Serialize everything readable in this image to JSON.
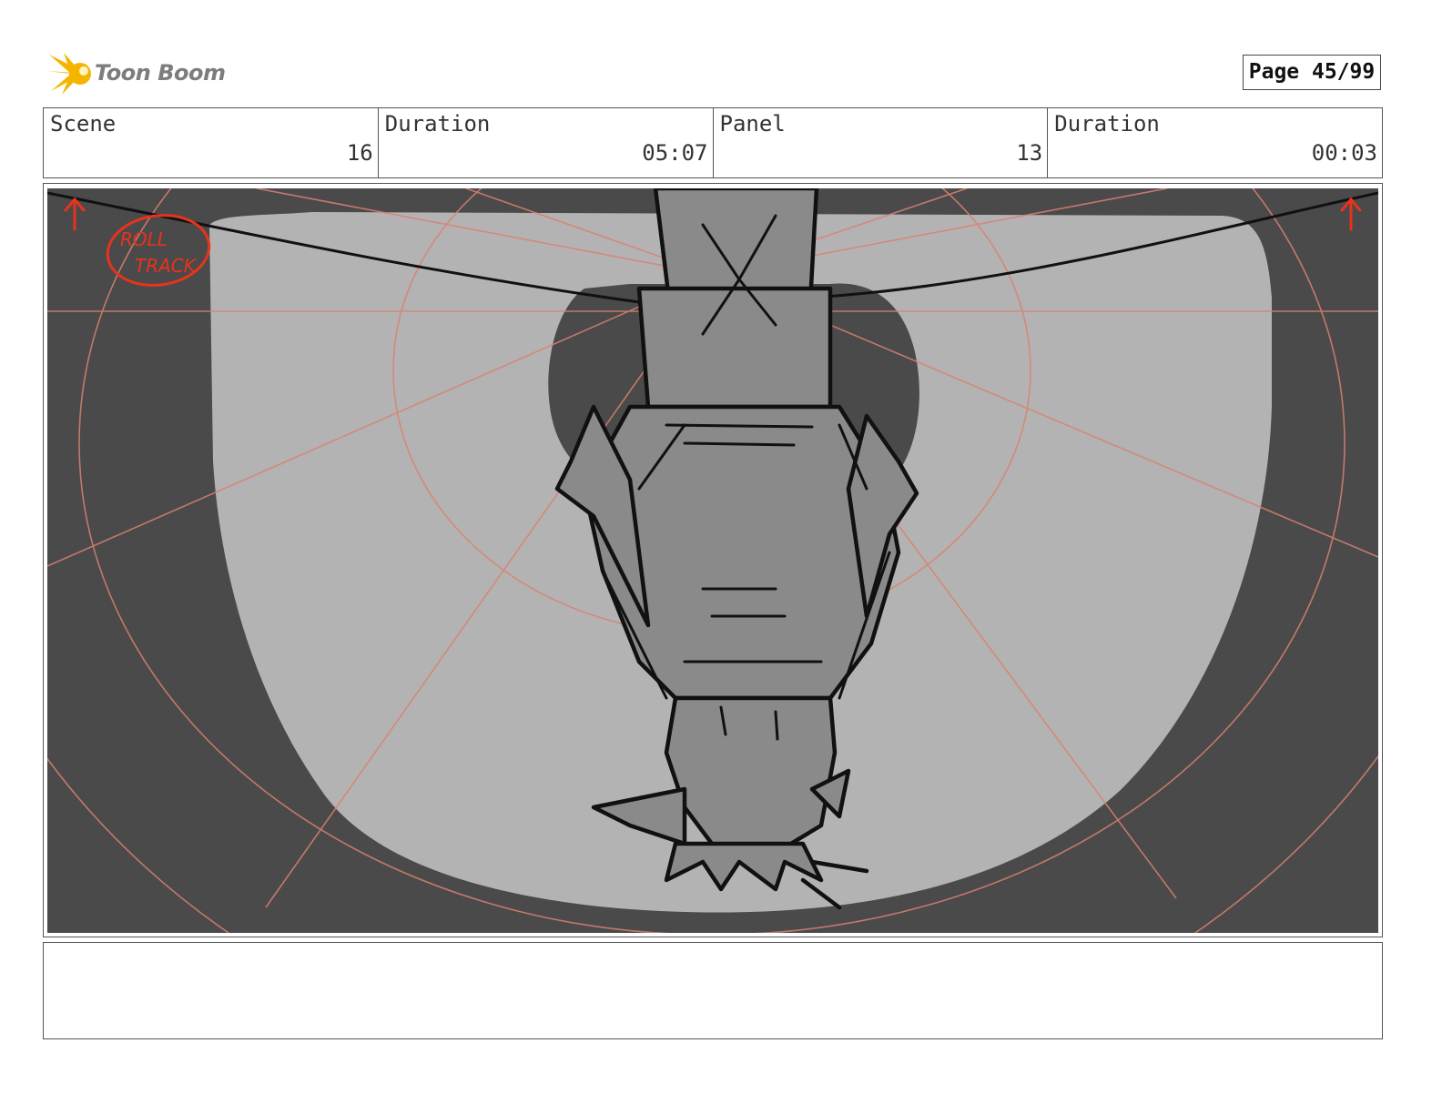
{
  "header": {
    "logo_text": "Toon Boom",
    "page_label": "Page 45/99"
  },
  "info": {
    "scene_label": "Scene",
    "scene_value": "16",
    "scene_duration_label": "Duration",
    "scene_duration_value": "05:07",
    "panel_label": "Panel",
    "panel_value": "13",
    "panel_duration_label": "Duration",
    "panel_duration_value": "00:03"
  },
  "panel": {
    "annotation_line1": "ROLL",
    "annotation_line2": "TRACK"
  },
  "notes": {
    "text": ""
  },
  "colors": {
    "logo_yellow": "#f5b400",
    "annotation_red": "#e8331c",
    "guide_red": "#d98270",
    "dark_bg": "#4a4a4a",
    "light_floor": "#b3b3b3",
    "figure_gray": "#8a8a8a"
  }
}
